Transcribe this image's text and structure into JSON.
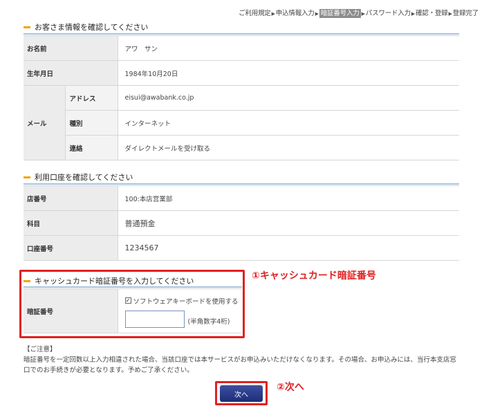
{
  "steps": [
    {
      "label": "ご利用規定",
      "active": false
    },
    {
      "label": "申込情報入力",
      "active": false
    },
    {
      "label": "暗証番号入力",
      "active": true
    },
    {
      "label": "パスワード入力",
      "active": false
    },
    {
      "label": "確認・登録",
      "active": false
    },
    {
      "label": "登録完了",
      "active": false
    }
  ],
  "customer": {
    "title": "お客さま情報を確認してください",
    "name_label": "お名前",
    "name_value": "アワ　サン",
    "birth_label": "生年月日",
    "birth_value": "1984年10月20日",
    "mail_label": "メール",
    "address_label": "アドレス",
    "address_value": "eisui@awabank.co.jp",
    "type_label": "種別",
    "type_value": "インターネット",
    "contact_label": "連絡",
    "contact_value": "ダイレクトメールを受け取る"
  },
  "account": {
    "title": "利用口座を確認してください",
    "branch_label": "店番号",
    "branch_value": "100:本店営業部",
    "subject_label": "科目",
    "subject_value": "普通預金",
    "number_label": "口座番号",
    "number_value": "1234567"
  },
  "pin": {
    "title": "キャッシュカード暗証番号を入力してください",
    "label": "暗証番号",
    "keyboard_checkbox_label": "ソフトウェアキーボードを使用する",
    "keyboard_checked": true,
    "input_value": "",
    "hint": "(半角数字4桁)"
  },
  "annotations": {
    "pin": "①キャッシュカード暗証番号",
    "next": "②次へ"
  },
  "notice": {
    "heading": "【ご注意】",
    "body": "暗証番号を一定回数以上入力相違された場合、当該口座では本サービスがお申込みいただけなくなります。その場合、お申込みには、当行本支店窓口でのお手続きが必要となります。予めご了承ください。"
  },
  "next_button": "次へ",
  "colors": {
    "accent_bar": "#f5a300",
    "annotation_red": "#e02020",
    "button_blue": "#1e2d78",
    "rule_blue": "#a9c3e0"
  }
}
